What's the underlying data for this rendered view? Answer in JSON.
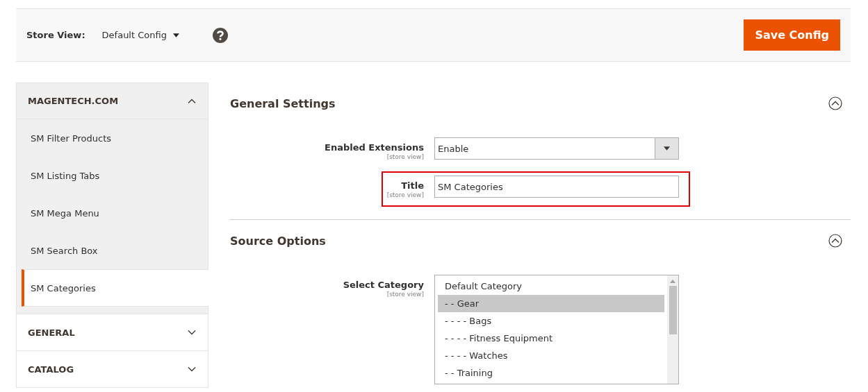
{
  "store_view": {
    "label": "Store View:",
    "value": "Default Config"
  },
  "save_button": "Save Config",
  "sidebar": {
    "groups": [
      {
        "title": "MAGENTECH.COM",
        "expanded": true,
        "items": [
          {
            "label": "SM Filter Products",
            "selected": false
          },
          {
            "label": "SM Listing Tabs",
            "selected": false
          },
          {
            "label": "SM Mega Menu",
            "selected": false
          },
          {
            "label": "SM Search Box",
            "selected": false
          },
          {
            "label": "SM Categories",
            "selected": true
          }
        ]
      },
      {
        "title": "GENERAL",
        "expanded": false
      },
      {
        "title": "CATALOG",
        "expanded": false
      }
    ]
  },
  "sections": [
    {
      "title": "General Settings",
      "expanded": true,
      "fields": [
        {
          "kind": "select",
          "label": "Enabled Extensions",
          "scope": "[store view]",
          "value": "Enable",
          "highlighted": false
        },
        {
          "kind": "text",
          "label": "Title",
          "scope": "[store view]",
          "value": "SM Categories",
          "highlighted": true
        }
      ]
    },
    {
      "title": "Source Options",
      "expanded": true,
      "fields": [
        {
          "kind": "multiselect",
          "label": "Select Category",
          "scope": "[store view]",
          "highlighted": false,
          "options": [
            {
              "label": "Default Category",
              "selected": false
            },
            {
              "label": "- - Gear",
              "selected": true
            },
            {
              "label": "- - - - Bags",
              "selected": false
            },
            {
              "label": "- - - - Fitness Equipment",
              "selected": false
            },
            {
              "label": "- - - - Watches",
              "selected": false
            },
            {
              "label": "- - Training",
              "selected": false
            }
          ]
        }
      ]
    }
  ]
}
